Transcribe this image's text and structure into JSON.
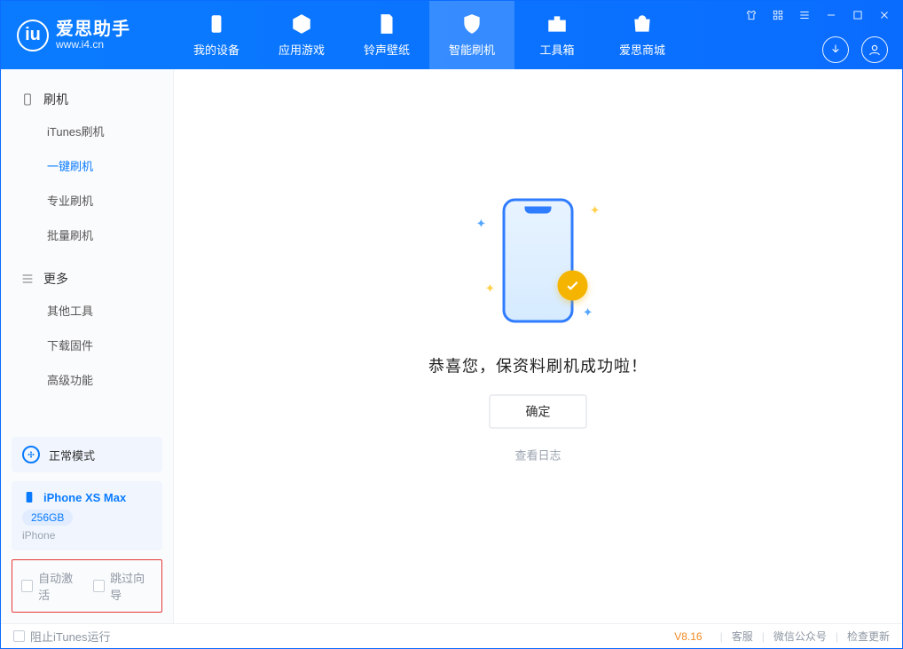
{
  "app": {
    "name": "爱思助手",
    "url": "www.i4.cn"
  },
  "tabs": [
    {
      "label": "我的设备"
    },
    {
      "label": "应用游戏"
    },
    {
      "label": "铃声壁纸"
    },
    {
      "label": "智能刷机"
    },
    {
      "label": "工具箱"
    },
    {
      "label": "爱思商城"
    }
  ],
  "active_tab_index": 3,
  "sidebar": {
    "section1_title": "刷机",
    "section1_items": [
      {
        "label": "iTunes刷机"
      },
      {
        "label": "一键刷机"
      },
      {
        "label": "专业刷机"
      },
      {
        "label": "批量刷机"
      }
    ],
    "section1_active_index": 1,
    "section2_title": "更多",
    "section2_items": [
      {
        "label": "其他工具"
      },
      {
        "label": "下载固件"
      },
      {
        "label": "高级功能"
      }
    ]
  },
  "mode": {
    "label": "正常模式"
  },
  "device": {
    "name": "iPhone XS Max",
    "storage": "256GB",
    "type": "iPhone"
  },
  "options": {
    "auto_activate": "自动激活",
    "skip_guide": "跳过向导"
  },
  "main": {
    "message": "恭喜您，保资料刷机成功啦！",
    "ok": "确定",
    "view_log": "查看日志"
  },
  "footer": {
    "block_itunes": "阻止iTunes运行",
    "version": "V8.16",
    "links": [
      "客服",
      "微信公众号",
      "检查更新"
    ]
  }
}
